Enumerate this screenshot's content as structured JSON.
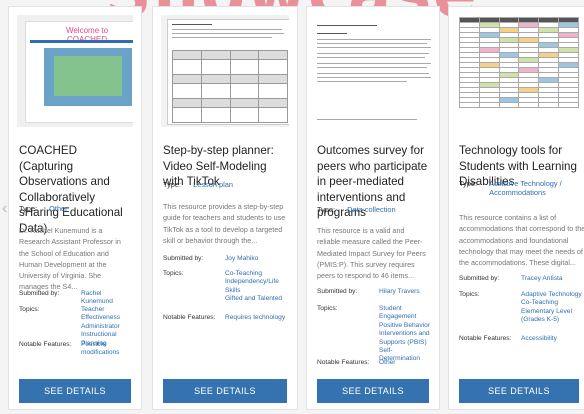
{
  "banner": "Showcase",
  "nav": {
    "prev_icon": "chevron-left-icon",
    "prev_label": "‹"
  },
  "cards": [
    {
      "thumb": {
        "title": "Welcome to COACHED"
      },
      "title": "COACHED (Capturing Observations and Collaboratively sHaring Educational Data)",
      "type_label": "Type:",
      "type_value": "Other",
      "description": "Dr. Rachel Kunemund is a Research Assistant Professor in the School of Education and Human Development at the University of Virginia. She manages the S4...",
      "submitted_label": "Submitted by:",
      "submitted_value": "Rachel Kunemund",
      "topics_label": "Topics:",
      "topics": [
        "Teacher Effectiveness",
        "Administrator",
        "Instructional Planning"
      ],
      "features_label": "Notable Features:",
      "features": [
        "Possible modifications"
      ],
      "button": "SEE DETAILS"
    },
    {
      "title": "Step-by-step planner: Video Self-Modeling with TikTok",
      "type_label": "Type:",
      "type_value": "Lesson plan",
      "description": "This resource provides a step-by-step guide for teachers and students to use TikTok as a tool to develop a targeted skill or behavior through the...",
      "submitted_label": "Submitted by:",
      "submitted_value": "Joy Mahiko",
      "topics_label": "Topics:",
      "topics": [
        "Co-Teaching",
        "Independency/Life Skills",
        "Gifted and Talented"
      ],
      "features_label": "Notable Features:",
      "features": [
        "Requires technology"
      ],
      "button": "SEE DETAILS"
    },
    {
      "title": "Outcomes survey for peers who participate in peer-mediated interventions and programs",
      "type_label": "Type:",
      "type_value": "Data collection",
      "description": "This resource is a valid and reliable measure called the Peer-Mediated Impact Survey for Peers (PMIS:P). This survey requires peers to respond to 46 items...",
      "submitted_label": "Submitted by:",
      "submitted_value": "Hilary Travers",
      "topics_label": "Topics:",
      "topics": [
        "Student Engagement",
        "Positive Behavior Interventions and Supports (PBIS)",
        "Self-Determination"
      ],
      "features_label": "Notable Features:",
      "features": [
        "Other"
      ],
      "button": "SEE DETAILS"
    },
    {
      "title": "Technology tools for Students with Learning Disabilities",
      "type_label": "Type:",
      "type_value": "Assistive Technology / Accommodations",
      "description": "This resource contains a list of accommodations that correspond to the accommodations and foundational technology that may meet the needs of the accommodations. These digital...",
      "submitted_label": "Submitted by:",
      "submitted_value": "Tracey Antista",
      "topics_label": "Topics:",
      "topics": [
        "Adaptive Technology",
        "Co-Teaching",
        "Elementary Level (Grades K-5)"
      ],
      "features_label": "Notable Features:",
      "features": [
        "Accessibility"
      ],
      "button": "SEE DETAILS"
    }
  ]
}
